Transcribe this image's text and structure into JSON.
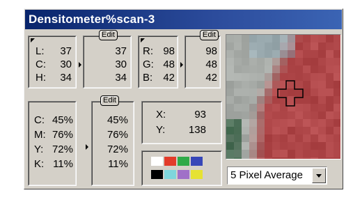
{
  "window": {
    "title": "Densitometer%scan-3"
  },
  "lch": {
    "edit_label": "Edit",
    "rows": [
      {
        "label": "L:",
        "original": "37",
        "adjusted": "37"
      },
      {
        "label": "C:",
        "original": "30",
        "adjusted": "30"
      },
      {
        "label": "H:",
        "original": "34",
        "adjusted": "34"
      }
    ]
  },
  "rgb": {
    "edit_label": "Edit",
    "rows": [
      {
        "label": "R:",
        "original": "98",
        "adjusted": "98"
      },
      {
        "label": "G:",
        "original": "48",
        "adjusted": "48"
      },
      {
        "label": "B:",
        "original": "42",
        "adjusted": "42"
      }
    ]
  },
  "cmyk": {
    "edit_label": "Edit",
    "rows": [
      {
        "label": "C:",
        "original": "45%",
        "adjusted": "45%"
      },
      {
        "label": "M:",
        "original": "76%",
        "adjusted": "76%"
      },
      {
        "label": "Y:",
        "original": "72%",
        "adjusted": "72%"
      },
      {
        "label": "K:",
        "original": "11%",
        "adjusted": "11%"
      }
    ]
  },
  "coords": {
    "x_label": "X:",
    "x_value": "93",
    "y_label": "Y:",
    "y_value": "138"
  },
  "swatches": [
    "#ffffff",
    "#e23b2a",
    "#2faa48",
    "#3646b8",
    "#000000",
    "#7fd6dc",
    "#a070c8",
    "#e6e233"
  ],
  "preview": {
    "icon": "crosshair-icon",
    "colors": {
      "dark_green": "#2d5a3c",
      "gray": "#a8aca8",
      "red": "#b0484a"
    }
  },
  "sample_size": {
    "selected": "5 Pixel Average"
  }
}
